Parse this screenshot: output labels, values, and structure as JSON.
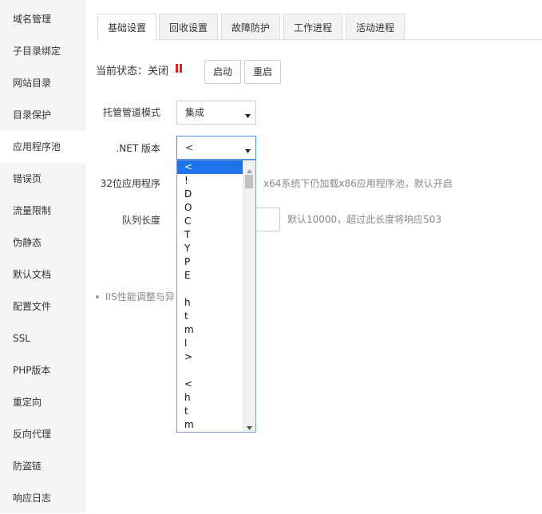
{
  "sidebar": {
    "items": [
      {
        "label": "域名管理"
      },
      {
        "label": "子目录绑定"
      },
      {
        "label": "网站目录"
      },
      {
        "label": "目录保护"
      },
      {
        "label": "应用程序池",
        "active": true
      },
      {
        "label": "错误页"
      },
      {
        "label": "流量限制"
      },
      {
        "label": "伪静态"
      },
      {
        "label": "默认文档"
      },
      {
        "label": "配置文件"
      },
      {
        "label": "SSL"
      },
      {
        "label": "PHP版本"
      },
      {
        "label": "重定向"
      },
      {
        "label": "反向代理"
      },
      {
        "label": "防盗链"
      },
      {
        "label": "响应日志"
      }
    ]
  },
  "tabs": [
    {
      "label": "基础设置",
      "active": true
    },
    {
      "label": "回收设置"
    },
    {
      "label": "故障防护"
    },
    {
      "label": "工作进程"
    },
    {
      "label": "活动进程"
    }
  ],
  "status": {
    "prefix": "当前状态：",
    "value": "关闭",
    "start_label": "启动",
    "restart_label": "重启",
    "icon": "pause-icon",
    "icon_color": "#e02020"
  },
  "form": {
    "pipeline_mode": {
      "label": "托管管道模式",
      "value": "集成"
    },
    "net_version": {
      "label": ".NET 版本",
      "value": "<"
    },
    "bit32": {
      "label": "32位应用程序",
      "hint": "x64系统下仍加载x86应用程序池，默认开启"
    },
    "queue_length": {
      "label": "队列长度",
      "hint": "默认10000，超过此长度将响应503"
    }
  },
  "note": "IIS性能调整与异",
  "dropdown": {
    "options": [
      "<",
      "!",
      "D",
      "O",
      "C",
      "T",
      "Y",
      "P",
      "E",
      "",
      "h",
      "t",
      "m",
      "l",
      ">",
      "",
      "<",
      "h",
      "t",
      "m"
    ]
  },
  "colors": {
    "accent": "#1e73e8",
    "status_icon": "#e02020"
  }
}
